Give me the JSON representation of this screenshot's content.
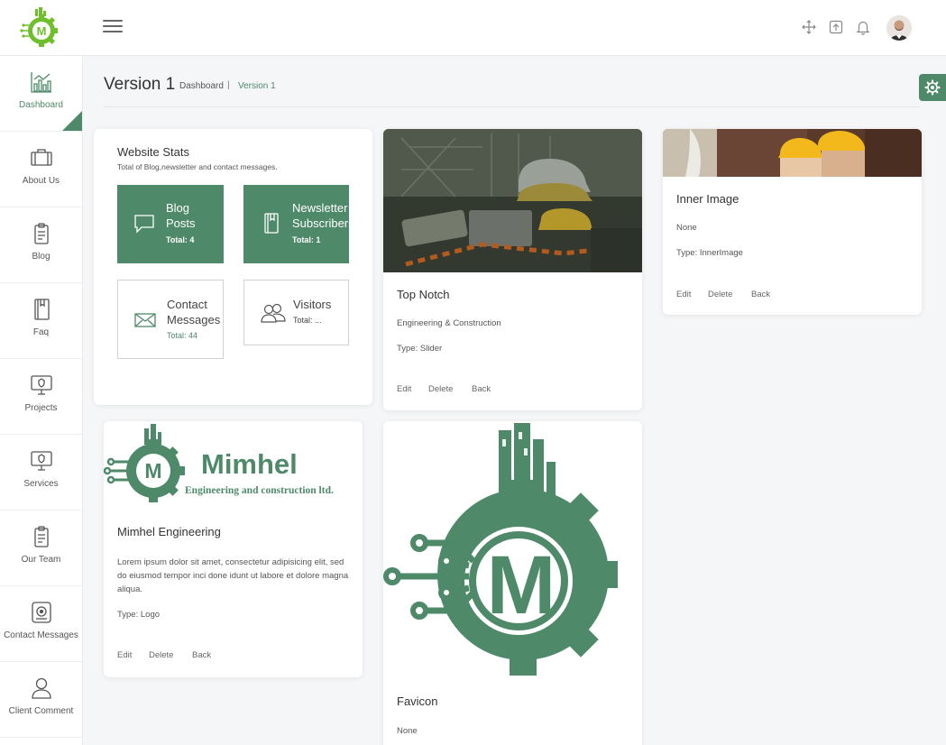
{
  "colors": {
    "accent": "#4e8a6a",
    "background": "#f5f6f8"
  },
  "brand": {
    "logo_letter": "M"
  },
  "topbar": {
    "icons": [
      "move-arrows-icon",
      "fullscreen-icon",
      "bell-icon"
    ]
  },
  "sidebar": {
    "items": [
      {
        "label": "Dashboard",
        "icon": "bar-chart-icon"
      },
      {
        "label": "About Us",
        "icon": "briefcase-icon"
      },
      {
        "label": "Blog",
        "icon": "clipboard-icon"
      },
      {
        "label": "Faq",
        "icon": "book-icon"
      },
      {
        "label": "Projects",
        "icon": "monitor-icon"
      },
      {
        "label": "Services",
        "icon": "monitor-icon"
      },
      {
        "label": "Our Team",
        "icon": "clipboard-icon"
      },
      {
        "label": "Contact Messages",
        "icon": "speaker-icon"
      },
      {
        "label": "Client Comment",
        "icon": "user-icon"
      }
    ]
  },
  "header": {
    "title": "Version 1",
    "breadcrumb": [
      "Dashboard",
      "Version 1"
    ],
    "separator": "|"
  },
  "stats": {
    "title": "Website Stats",
    "subtitle": "Total of Blog,newsletter and contact messages.",
    "tiles": [
      {
        "title": "Blog\nPosts",
        "total": "Total: 4"
      },
      {
        "title": "Newsletter\nSubscribers",
        "total": "Total: 1"
      },
      {
        "title": "Contact\nMessages",
        "total": "Total: 44"
      },
      {
        "title": "Visitors",
        "total": "Total: ..."
      }
    ]
  },
  "cards": [
    {
      "title": "Top Notch",
      "description": "Engineering & Construction",
      "type": "Type: Slider",
      "actions": [
        "Edit",
        "Delete",
        "Back"
      ]
    },
    {
      "title": "Inner Image",
      "description": "None",
      "type": "Type: InnerImage",
      "actions": [
        "Edit",
        "Delete",
        "Back"
      ]
    },
    {
      "title": "Mimhel Engineering",
      "description": "Lorem ipsum dolor sit amet, consectetur adipisicing elit, sed do eiusmod tempor inci done idunt ut labore et dolore magna aliqua.",
      "type": "Type: Logo",
      "actions": [
        "Edit",
        "Delete",
        "Back"
      ],
      "image_text": {
        "name": "Mimhel",
        "tagline": "Engineering and construction ltd."
      }
    },
    {
      "title": "Favicon",
      "description": "None"
    }
  ]
}
